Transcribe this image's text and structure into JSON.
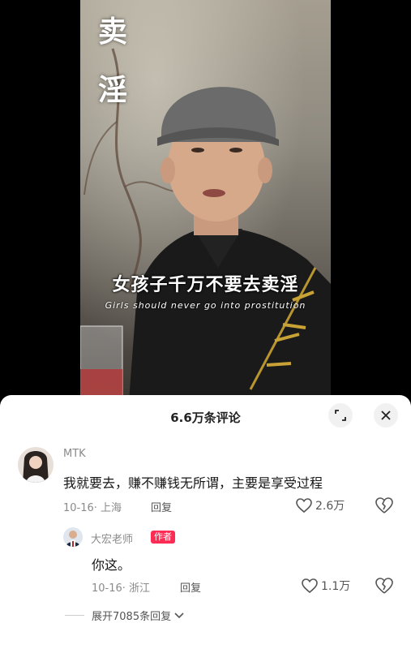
{
  "video": {
    "side_text": [
      "卖",
      "淫"
    ],
    "subtitle_zh": "女孩子千万不要去卖淫",
    "subtitle_en": "Girls should never go into prostitution"
  },
  "comments_panel": {
    "title": "6.6万条评论",
    "expand_icon": "expand-icon",
    "close_icon": "close-icon"
  },
  "comments": [
    {
      "username": "MTK",
      "text": "我就要去，赚不赚钱无所谓，主要是享受过程",
      "date_location": "10-16· 上海",
      "reply_label": "回复",
      "likes": "2.6万"
    }
  ],
  "reply": {
    "username": "大宏老师",
    "badge": "作者",
    "text": "你这。",
    "date_location": "10-16· 浙江",
    "reply_label": "回复",
    "likes": "1.1万"
  },
  "expand_replies": "展开7085条回复",
  "colors": {
    "accent": "#fe2c55",
    "muted_text": "#8a8a8a"
  }
}
